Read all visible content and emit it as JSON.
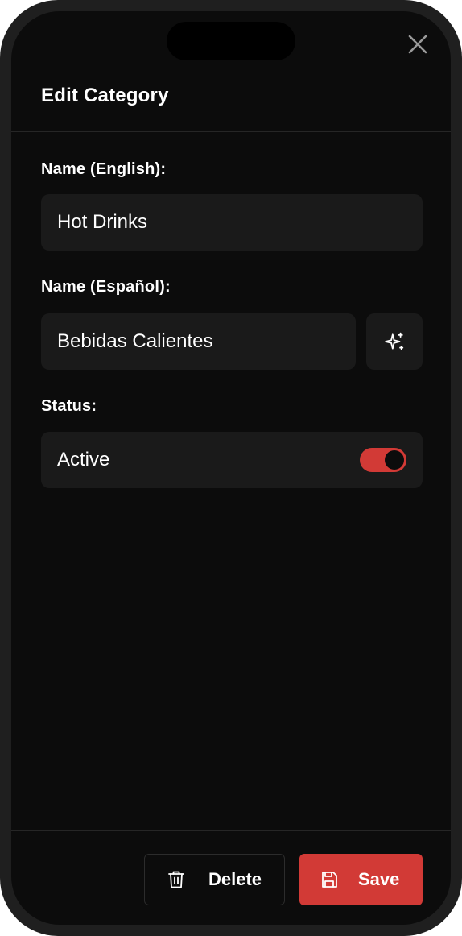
{
  "form": {
    "title": "Edit Category",
    "name_en": {
      "label": "Name (English):",
      "value": "Hot Drinks"
    },
    "name_es": {
      "label": "Name (Español):",
      "value": "Bebidas Calientes"
    },
    "status": {
      "label": "Status:",
      "value": "Active",
      "enabled": true
    }
  },
  "actions": {
    "delete_label": "Delete",
    "save_label": "Save"
  },
  "icons": {
    "close": "close-icon",
    "translate": "sparkles-icon",
    "delete": "trash-icon",
    "save": "save-icon"
  },
  "colors": {
    "accent": "#d23a36",
    "screen_bg": "#0c0c0c",
    "field_bg": "#1a1a1a",
    "text": "#ffffff"
  }
}
